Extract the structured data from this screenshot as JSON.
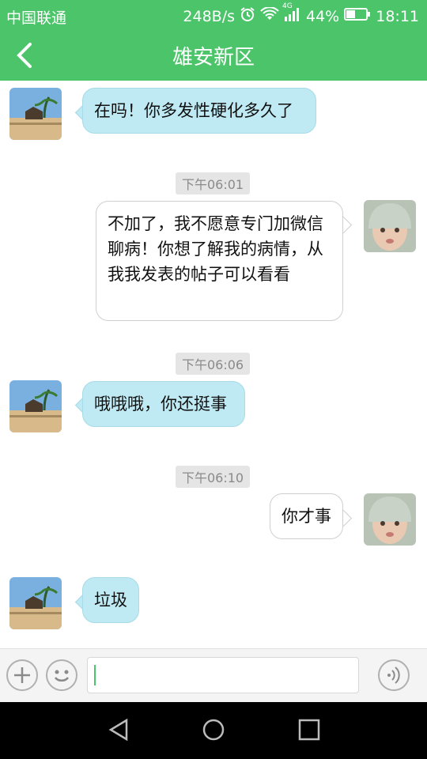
{
  "status_bar": {
    "carrier": "中国联通",
    "speed": "248B/s",
    "network": "4G",
    "battery": "44%",
    "time": "18:11"
  },
  "app_bar": {
    "title": "雄安新区"
  },
  "messages": [
    {
      "side": "in",
      "text": "在吗！你多发性硬化多久了"
    },
    {
      "timestamp": "下午06:01"
    },
    {
      "side": "out",
      "text": "不加了，我不愿意专门加微信聊病！你想了解我的病情，从我我发表的帖子可以看看"
    },
    {
      "timestamp": "下午06:06"
    },
    {
      "side": "in",
      "text": "哦哦哦，你还挺事"
    },
    {
      "timestamp": "下午06:10"
    },
    {
      "side": "out",
      "text": "你才事"
    },
    {
      "side": "in",
      "text": "垃圾"
    }
  ],
  "input_bar": {
    "value": ""
  },
  "colors": {
    "brand_green": "#4cc56a",
    "incoming_bubble": "#bfeaf3",
    "outgoing_bubble": "#ffffff"
  }
}
